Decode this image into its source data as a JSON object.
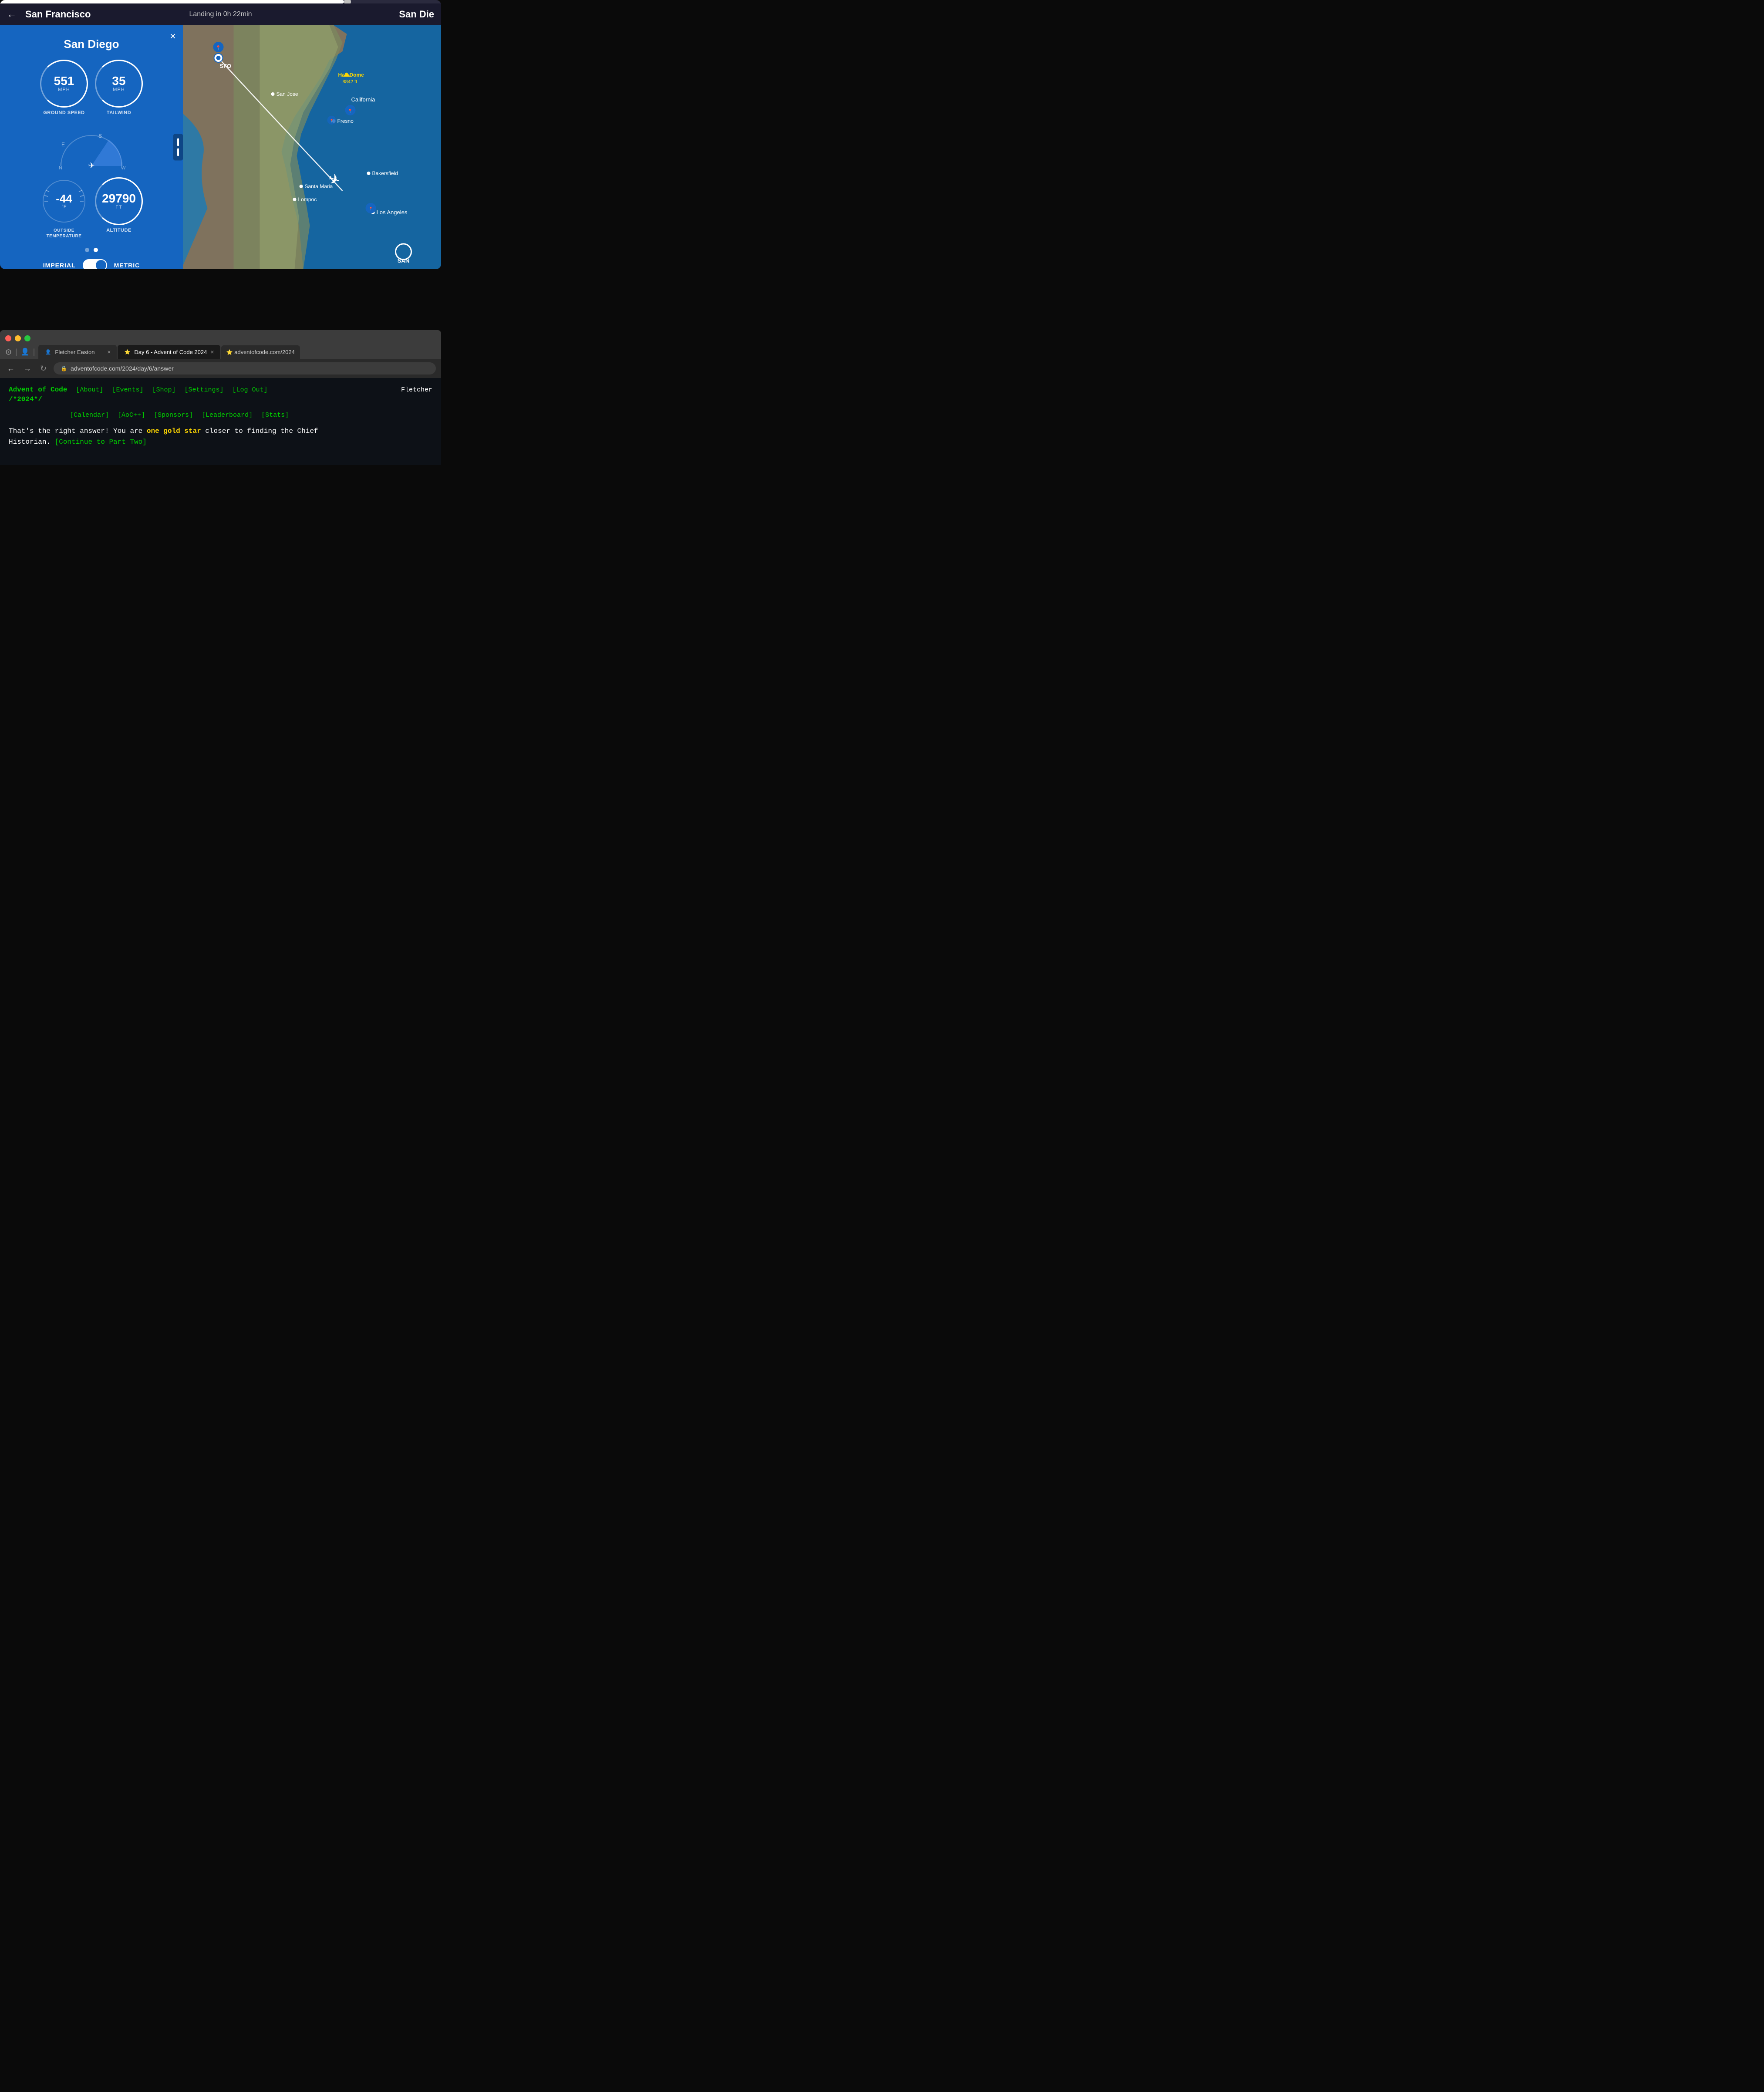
{
  "flight_app": {
    "progress_percent": 78,
    "header": {
      "back_label": "←",
      "origin": "San Francisco",
      "eta": "Landing in 0h 22min",
      "destination_partial": "San Die"
    },
    "panel": {
      "close_label": "×",
      "destination": "San Diego",
      "ground_speed_value": "551",
      "ground_speed_unit": "MPH",
      "ground_speed_label": "GROUND SPEED",
      "tailwind_value": "35",
      "tailwind_unit": "MPH",
      "tailwind_label": "TAILWIND",
      "compass": {
        "labels": [
          "E",
          "S"
        ],
        "directions": [
          "N",
          "W"
        ]
      },
      "temperature_value": "-44",
      "temperature_unit": "°F",
      "temperature_label": "OUTSIDE\nTEMPERATURE",
      "altitude_value": "29790",
      "altitude_unit": "FT",
      "altitude_label": "ALTITUDE",
      "toggle_imperial": "IMPERIAL",
      "toggle_metric": "METRIC",
      "pause_label": "||"
    },
    "map": {
      "cities": [
        {
          "name": "San Jose",
          "dot": true
        },
        {
          "name": "California",
          "dot": false
        },
        {
          "name": "Fresno",
          "dot": true
        },
        {
          "name": "Bakersfield",
          "dot": true
        },
        {
          "name": "Santa Maria",
          "dot": true
        },
        {
          "name": "Lompoc",
          "dot": true
        },
        {
          "name": "Los Angeles",
          "dot": true
        }
      ],
      "highlight": {
        "name": "Half Dome",
        "value": "8842 ft"
      },
      "sfo_label": "SFO",
      "san_label": "SAN"
    }
  },
  "browser": {
    "traffic_lights": [
      "red",
      "yellow",
      "green"
    ],
    "tabs": [
      {
        "label": "Fletcher Easton",
        "favicon": "👤",
        "active": false,
        "closeable": true
      },
      {
        "label": "Day 6 - Advent of Code 2024",
        "favicon": "⭐",
        "active": true,
        "closeable": true
      },
      {
        "label": "adventofcode.com/2024",
        "favicon": "⭐",
        "active": false,
        "closeable": false
      }
    ],
    "address": "adventofcode.com/2024/day/6/answer",
    "nav": {
      "brand_line1": "Advent of Code",
      "brand_line2": "/*2024*/",
      "links_row1": [
        "[About]",
        "[Events]",
        "[Shop]",
        "[Settings]",
        "[Log Out]"
      ],
      "links_row2": [
        "[Calendar]",
        "[AoC++]",
        "[Sponsors]",
        "[Leaderboard]",
        "[Stats]"
      ],
      "user": "Fletcher"
    },
    "result": {
      "line1": "That's the right answer! You are ",
      "highlight": "one gold star",
      "line1_end": " closer to finding the Chief",
      "line2": "Historian. ",
      "continue_link": "[Continue to Part Two]"
    }
  }
}
